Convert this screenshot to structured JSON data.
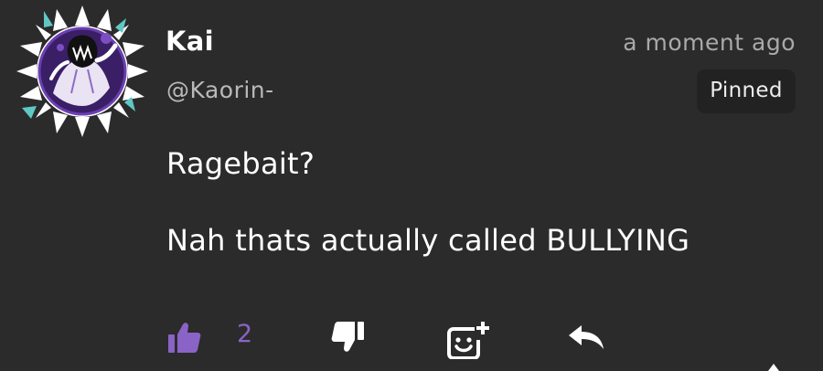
{
  "comment": {
    "author": {
      "display_name": "Kai",
      "handle": "@Kaorin-",
      "avatar_icon": "avatar-image"
    },
    "timestamp": "a moment ago",
    "badge": "Pinned",
    "body": {
      "line1": "Ragebait?",
      "line2": "Nah thats actually called BULLYING"
    },
    "actions": {
      "like_icon": "thumbs-up-icon",
      "like_count": "2",
      "dislike_icon": "thumbs-down-icon",
      "emoji_icon": "add-emoji-icon",
      "reply_icon": "reply-icon"
    }
  },
  "colors": {
    "background": "#2b2b2b",
    "accent": "#8a63c7",
    "text": "#ffffff",
    "muted_text": "#b9b9b9",
    "badge_bg": "#222222"
  }
}
